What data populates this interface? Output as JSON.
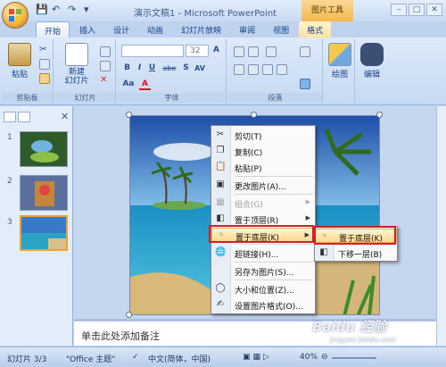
{
  "titlebar": {
    "title": "演示文稿1 - Microsoft PowerPoint",
    "context_tab_group": "图片工具"
  },
  "ribbon_tabs": [
    "开始",
    "插入",
    "设计",
    "动画",
    "幻灯片放映",
    "审阅",
    "视图",
    "格式"
  ],
  "ribbon": {
    "paste_label": "粘贴",
    "new_slide_label": "新建\n幻灯片",
    "font_size": "32",
    "drawing_label": "绘图",
    "editing_label": "编辑",
    "groups": {
      "clipboard": "剪贴板",
      "slides": "幻灯片",
      "font": "字体",
      "paragraph": "段落"
    },
    "font_buttons": [
      "B",
      "I",
      "U",
      "abe",
      "S",
      "AV",
      "Aa",
      "A"
    ]
  },
  "slides_panel": {
    "numbers": [
      "1",
      "2",
      "3"
    ]
  },
  "notes": {
    "placeholder": "单击此处添加备注"
  },
  "statusbar": {
    "slide_count": "幻灯片 3/3",
    "theme": "\"Office 主题\"",
    "language": "中文(简体，中国)",
    "zoom": "40%"
  },
  "context_menu": {
    "items": [
      {
        "label": "剪切(T)",
        "icon": "scissors-icon"
      },
      {
        "label": "复制(C)",
        "icon": "copy-icon"
      },
      {
        "label": "粘贴(P)",
        "icon": "paste-icon"
      },
      {
        "label": "更改图片(A)...",
        "icon": "change-picture-icon"
      },
      {
        "label": "组合(G)",
        "icon": "group-icon",
        "disabled": true
      },
      {
        "label": "置于顶层(R)",
        "icon": "bring-front-icon"
      },
      {
        "label": "置于底层(K)",
        "icon": "send-back-icon",
        "highlighted": true
      },
      {
        "label": "超链接(H)...",
        "icon": "hyperlink-icon"
      },
      {
        "label": "另存为图片(S)...",
        "icon": "save-picture-icon"
      },
      {
        "label": "大小和位置(Z)...",
        "icon": "size-position-icon"
      },
      {
        "label": "设置图片格式(O)...",
        "icon": "format-picture-icon"
      }
    ]
  },
  "submenu": {
    "items": [
      {
        "label": "置于底层(K)",
        "highlighted": true
      },
      {
        "label": "下移一层(B)"
      }
    ]
  },
  "watermark": {
    "text": "Baidu 经验",
    "url": "jingyan.baidu.com"
  }
}
